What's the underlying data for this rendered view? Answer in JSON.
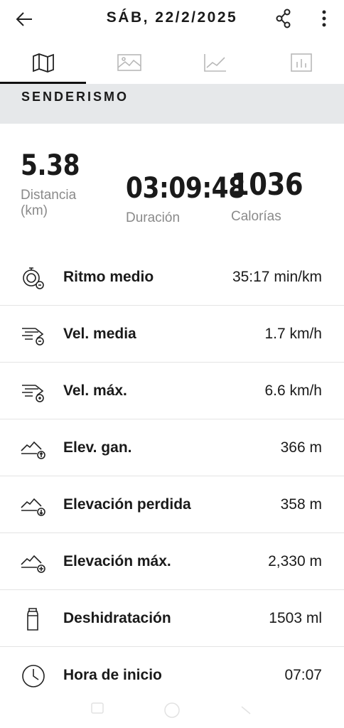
{
  "header": {
    "title": "SÁB, 22/2/2025",
    "back_icon": "arrow-left-icon",
    "share_icon": "share-icon",
    "more_icon": "more-vertical-icon"
  },
  "tabs": [
    {
      "name": "map",
      "icon": "map-icon",
      "active": true
    },
    {
      "name": "photos",
      "icon": "image-icon",
      "active": false
    },
    {
      "name": "charts",
      "icon": "line-chart-icon",
      "active": false
    },
    {
      "name": "laps",
      "icon": "bar-chart-icon",
      "active": false
    }
  ],
  "activity_type": "SENDERISMO",
  "summary": {
    "distance": {
      "value": "5.38",
      "label": "Distancia\n(km)"
    },
    "duration": {
      "value": "03:09:48",
      "label": "Duración"
    },
    "calories": {
      "value": "1036",
      "label": "Calorías"
    }
  },
  "metrics": [
    {
      "label": "Ritmo medio",
      "value": "35:17 min/km",
      "icon": "stopwatch-pace-icon"
    },
    {
      "label": "Vel. media",
      "value": "1.7 km/h",
      "icon": "speed-average-icon"
    },
    {
      "label": "Vel. máx.",
      "value": "6.6 km/h",
      "icon": "speed-max-icon"
    },
    {
      "label": "Elev. gan.",
      "value": "366 m",
      "icon": "elevation-gain-icon"
    },
    {
      "label": "Elevación perdida",
      "value": "358 m",
      "icon": "elevation-loss-icon"
    },
    {
      "label": "Elevación máx.",
      "value": "2,330 m",
      "icon": "elevation-max-icon"
    },
    {
      "label": "Deshidratación",
      "value": "1503 ml",
      "icon": "bottle-icon"
    },
    {
      "label": "Hora de inicio",
      "value": "07:07",
      "icon": "clock-icon"
    }
  ],
  "system_nav": [
    "recent-apps-icon",
    "home-icon",
    "back-nav-icon"
  ]
}
